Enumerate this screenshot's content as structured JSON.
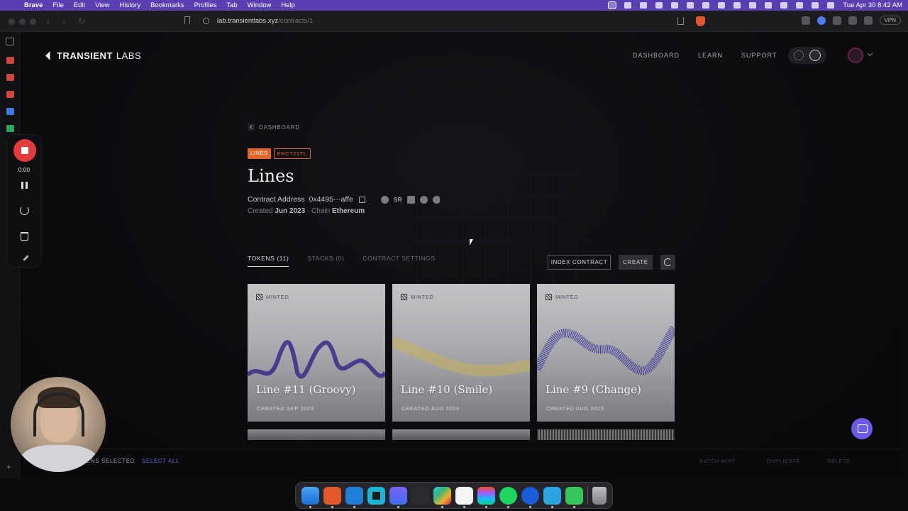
{
  "menubar": {
    "app": "Brave",
    "items": [
      "File",
      "Edit",
      "View",
      "History",
      "Bookmarks",
      "Profiles",
      "Tab",
      "Window",
      "Help"
    ],
    "clock": "Tue Apr 30  8:42 AM"
  },
  "browser": {
    "url_host": "lab.transientlabs.xyz",
    "url_path": "/contracts/1",
    "vpn_label": "VPN"
  },
  "recorder": {
    "time": "0:00"
  },
  "site": {
    "logo_bold": "TRANSIENT",
    "logo_light": "LABS",
    "nav": [
      "DASHBOARD",
      "LEARN",
      "SUPPORT"
    ]
  },
  "contract": {
    "breadcrumb": "DASHBOARD",
    "tag_symbol": "LINES",
    "tag_type": "ERC721TL",
    "title": "Lines",
    "address_label": "Contract Address",
    "address": "0x4495···affe",
    "sr_label": "SR",
    "created_label": "Created",
    "created_value": "Jun 2023",
    "chain_label": "· Chain",
    "chain_value": "Ethereum"
  },
  "tabs": [
    {
      "label": "TOKENS (11)",
      "active": true
    },
    {
      "label": "STACKS (0)",
      "active": false
    },
    {
      "label": "CONTRACT SETTINGS",
      "active": false
    }
  ],
  "actions": {
    "index": "INDEX CONTRACT",
    "create": "CREATE"
  },
  "tokens": [
    {
      "status": "MINTED",
      "name": "Line #11 (Groovy)",
      "created": "CREATED SEP 2023",
      "line_color": "#3a2a8a"
    },
    {
      "status": "MINTED",
      "name": "Line #10 (Smile)",
      "created": "CREATED AUG 2023",
      "line_color": "#c9b25a"
    },
    {
      "status": "MINTED",
      "name": "Line #9 (Change)",
      "created": "CREATED AUG 2023",
      "line_color": "#2e2a9a"
    }
  ],
  "bottom_bar": {
    "selected": "KENS SELECTED",
    "select_all": "SELECT ALL",
    "batch_mint": "BATCH MINT",
    "duplicate": "DUPLICATE",
    "delete": "DELETE"
  },
  "colors": {
    "accent_orange": "#e06528",
    "menubar_purple": "#5a3fb3",
    "select_all_blue": "#5d63c7",
    "recorder_red": "#e33b3b"
  },
  "dock_apps": [
    "finder-icon",
    "brave-icon",
    "vscode-icon",
    "cursor-app-icon",
    "arc-icon",
    "terminal-icon",
    "slack-icon",
    "notion-icon",
    "figma-icon",
    "spotify-icon",
    "1password-icon",
    "telegram-icon",
    "messages-icon",
    "trash-icon"
  ]
}
